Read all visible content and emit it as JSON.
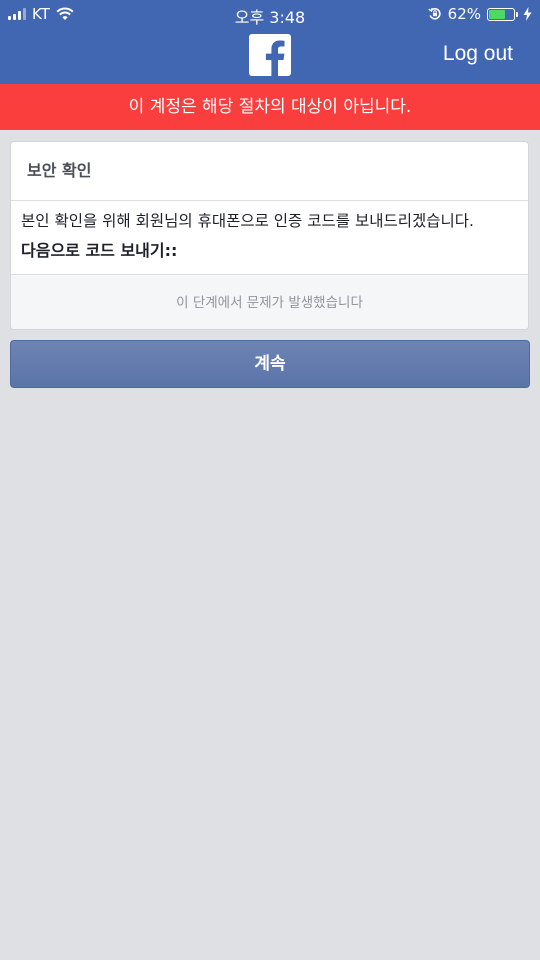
{
  "status_bar": {
    "carrier": "KT",
    "time": "오후 3:48",
    "battery_percent_label": "62%",
    "battery_level": 0.62,
    "icons": [
      "signal-icon",
      "wifi-icon",
      "orientation-lock-icon",
      "battery-icon",
      "charging-bolt-icon"
    ]
  },
  "nav": {
    "logo": "facebook-f-logo",
    "logout_label": "Log out",
    "background_color": "#4267b2"
  },
  "error_banner": {
    "message": "이 계정은 해당 절차의 대상이 아닙니다.",
    "background_color": "#fa3e3e"
  },
  "card": {
    "title": "보안 확인",
    "description": "본인 확인을 위해 회원님의 휴대폰으로 인증 코드를 보내드리겠습니다.",
    "send_label": "다음으로 코드 보내기::",
    "problem_link": "이 단계에서 문제가 발생했습니다"
  },
  "continue_button": {
    "label": "계속"
  }
}
